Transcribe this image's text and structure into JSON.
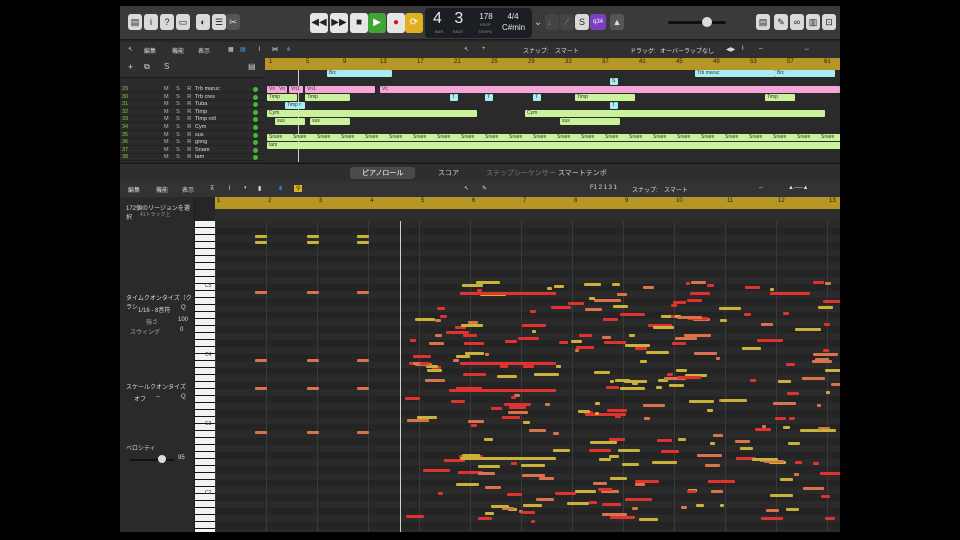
{
  "control_bar": {
    "lcd_position": "4 3",
    "lcd_bar_label": "BAR",
    "lcd_beat_label": "BEAT",
    "tempo": "178",
    "tempo_mode": "KEEP",
    "tempo_label": "TEMPO",
    "signature": "4/4",
    "key": "C#min",
    "cpu_badge": "q34"
  },
  "tracks_toolbar": {
    "edit": "編集",
    "functions": "機能",
    "view": "表示",
    "snap_label": "スナップ:",
    "snap_value": "スマート",
    "drag_label": "ドラッグ:",
    "drag_value": "オーバーラップなし"
  },
  "tracks_ruler": [
    "1",
    "5",
    "9",
    "13",
    "17",
    "21",
    "25",
    "29",
    "33",
    "37",
    "41",
    "45",
    "49",
    "53",
    "57",
    "61"
  ],
  "tracks": [
    {
      "num": "29",
      "name": "Trb maruc"
    },
    {
      "num": "30",
      "name": "Trb cres"
    },
    {
      "num": "31",
      "name": "Tuba"
    },
    {
      "num": "32",
      "name": "Timp"
    },
    {
      "num": "33",
      "name": "Timp roll"
    },
    {
      "num": "34",
      "name": "Cym"
    },
    {
      "num": "35",
      "name": "sus"
    },
    {
      "num": "36",
      "name": "gong"
    },
    {
      "num": "37",
      "name": "Snare"
    },
    {
      "num": "38",
      "name": "tam"
    }
  ],
  "msr_label": "M S R",
  "regions": {
    "brc": "Brc",
    "trb_maruc": "Trb maruc",
    "s": "S",
    "vn": "Vn",
    "vn1": "Vn1",
    "vc": "Vc",
    "timp": "Timp",
    "t": "T",
    "timpr": "Timp r",
    "cym": "Cym",
    "sus": "sus",
    "snare": "Snare",
    "tam": "tam"
  },
  "piano_roll": {
    "tabs": [
      "ピアノロール",
      "スコア",
      "ステップシーケンサー",
      "スマートテンポ"
    ],
    "toolbar_edit": "編集",
    "toolbar_functions": "機能",
    "toolbar_view": "表示",
    "position": "F1  2 1 3 1",
    "snap_label": "スナップ:",
    "snap_value": "スマート",
    "selection_title": "172個のリージョンを選択",
    "selection_sub": "41トラック上",
    "time_quantize": "タイムクオンタイズ（クラシ",
    "quantize_value": "1/16 - 8音符",
    "strength_label": "強さ",
    "strength_value": "100",
    "swing_label": "スウィング",
    "swing_value": "0",
    "scale_quantize": "スケールクオンタイズ",
    "scale_off": "オフ",
    "scale_dash": "--",
    "velocity_label": "ベロシティ",
    "velocity_value": "95",
    "ruler": [
      "1",
      "2",
      "3",
      "4",
      "5",
      "6",
      "7",
      "8",
      "9",
      "10",
      "11",
      "12",
      "13"
    ],
    "octaves": [
      "C5",
      "C4",
      "C3",
      "C2"
    ]
  },
  "colors": {
    "ruler": "#b59627",
    "note_red": "#e0332f",
    "note_orange": "#d9744a",
    "note_yellow": "#c9b23a",
    "region_green": "#c9f29a",
    "region_cyan": "#a6eef2",
    "region_pink": "#f4a6d8"
  }
}
